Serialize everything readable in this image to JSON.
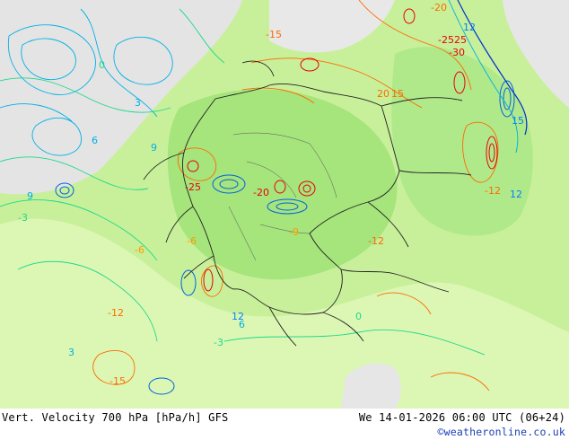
{
  "caption": {
    "left": "Vert. Velocity 700 hPa [hPa/h] GFS",
    "right": "We 14-01-2026 06:00 UTC (06+24)",
    "credit": "©weatheronline.co.uk"
  },
  "map": {
    "colors": {
      "land_light": "#d6f5a8",
      "land_mid": "#b4ec86",
      "land_strong": "#98e070",
      "sea_gray": "#e6e6e6",
      "border": "#222222",
      "ascent_contour": "#ff6a00",
      "ascent_strong": "#e8000a",
      "descent_contour": "#00b0e6",
      "descent_strong": "#0030d0",
      "descent_green": "#1fd88a"
    },
    "labels": [
      {
        "text": "-20",
        "color": "#ff6a00"
      },
      {
        "text": "-25",
        "color": "#e8000a"
      },
      {
        "text": "25",
        "color": "#e8000a"
      },
      {
        "text": "-30",
        "color": "#e8000a"
      },
      {
        "text": "-15",
        "color": "#ff6a00"
      },
      {
        "text": "20",
        "color": "#ff6a00"
      },
      {
        "text": "15",
        "color": "#ff6a00"
      },
      {
        "text": "-25",
        "color": "#e8000a"
      },
      {
        "text": "12",
        "color": "#0080ff"
      },
      {
        "text": "15",
        "color": "#0080ff"
      },
      {
        "text": "12",
        "color": "#0080ff"
      },
      {
        "text": "9",
        "color": "#00b0e6"
      },
      {
        "text": "6",
        "color": "#00b0e6"
      },
      {
        "text": "3",
        "color": "#00b0e6"
      },
      {
        "text": "0",
        "color": "#1fd88a"
      },
      {
        "text": "-3",
        "color": "#1fd88a"
      },
      {
        "text": "-6",
        "color": "#ff9900"
      },
      {
        "text": "-9",
        "color": "#ff9900"
      },
      {
        "text": "-12",
        "color": "#ff6a00"
      },
      {
        "text": "-12",
        "color": "#ff6a00"
      },
      {
        "text": "-15",
        "color": "#ff6a00"
      },
      {
        "text": "-20",
        "color": "#e8000a"
      },
      {
        "text": "12",
        "color": "#0080ff"
      },
      {
        "text": "6",
        "color": "#00b0e6"
      },
      {
        "text": "-3",
        "color": "#1fd88a"
      },
      {
        "text": "-12",
        "color": "#ff6a00"
      },
      {
        "text": "9",
        "color": "#00b0e6"
      },
      {
        "text": "-6",
        "color": "#ff9900"
      },
      {
        "text": "3",
        "color": "#00b0e6"
      },
      {
        "text": "0",
        "color": "#1fd88a"
      }
    ]
  }
}
